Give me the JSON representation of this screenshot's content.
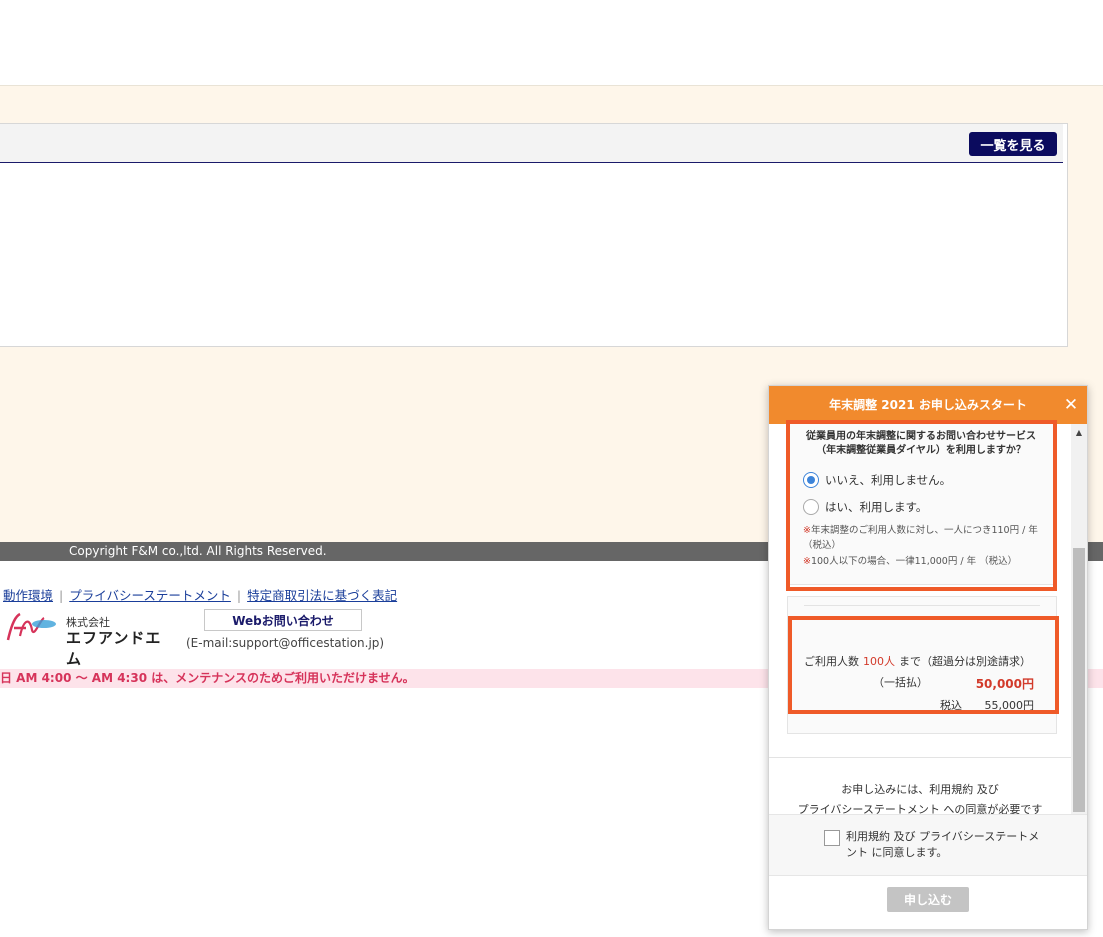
{
  "panel": {
    "view_all_label": "一覧を見る"
  },
  "copyright": "Copyright F&M co.,ltd. All Rights Reserved.",
  "footer": {
    "links": [
      "動作環境",
      "プライバシーステートメント",
      "特定商取引法に基づく表記"
    ],
    "separator": "|",
    "logo_small": "株式会社",
    "logo_big": "エフアンドエム",
    "web_contact_label": "Webお問い合わせ",
    "email": "(E-mail:support@officestation.jp)",
    "maintenance": "日 AM 4:00 ～ AM 4:30 は、メンテナンスのためご利用いただけません。"
  },
  "modal": {
    "title": "年末調整 2021 お申し込みスタート",
    "close": "✕",
    "question_line1": "従業員用の年末調整に関するお問い合わせサービス",
    "question_line2": "（年末調整従業員ダイヤル）を利用しますか？",
    "option_no": "いいえ、利用しません。",
    "option_yes": "はい、利用します。",
    "selected": "no",
    "note_mark": "※",
    "note1": "年末調整のご利用人数に対し、一人につき110円 / 年 （税込）",
    "note2": "100人以下の場合、一律11,000円 / 年 （税込）",
    "plan": {
      "users_label": "ご利用人数",
      "users_value": "100人",
      "users_suffix": "まで（超過分は別途請求）",
      "payment": "（一括払）",
      "price": "50,000円",
      "tax_label": "税込",
      "tax_price": "55,000円"
    },
    "terms_line1": "お申し込みには、利用規約 及び",
    "terms_line2": "プライバシーステートメント への同意が必要です",
    "agree_label": "利用規約 及び プライバシーステートメント に同意します。",
    "submit_label": "申し込む",
    "scroll_up": "▲"
  },
  "colors": {
    "accent": "#f18a2d",
    "highlight": "#ef5a28",
    "navy": "#0b0b5e",
    "price_red": "#d23a2a"
  }
}
